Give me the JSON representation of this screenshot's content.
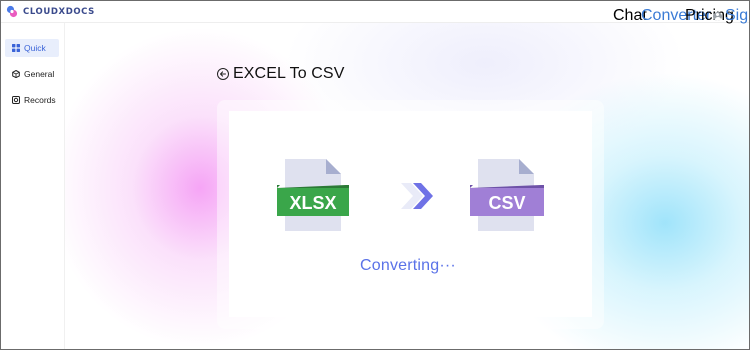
{
  "header": {
    "logo_text": "CLOUDXDOCS",
    "nav": {
      "chat": "Chat",
      "converter": "Converter",
      "pricing": "Pricing",
      "sign_in": "Sign In"
    }
  },
  "sidebar": {
    "items": [
      {
        "label": "Quick",
        "icon": "grid-icon",
        "active": true
      },
      {
        "label": "General",
        "icon": "cube-icon",
        "active": false
      },
      {
        "label": "Records",
        "icon": "record-icon",
        "active": false
      }
    ]
  },
  "main": {
    "title": "EXCEL To CSV",
    "source_format": "XLSX",
    "target_format": "CSV",
    "status": "Converting···"
  },
  "colors": {
    "accent": "#3a7bd5",
    "xlsx_band": "#3aa64a",
    "csv_band": "#a07fd6",
    "status_text": "#5a72e8",
    "arrow": "#6f72e6"
  }
}
